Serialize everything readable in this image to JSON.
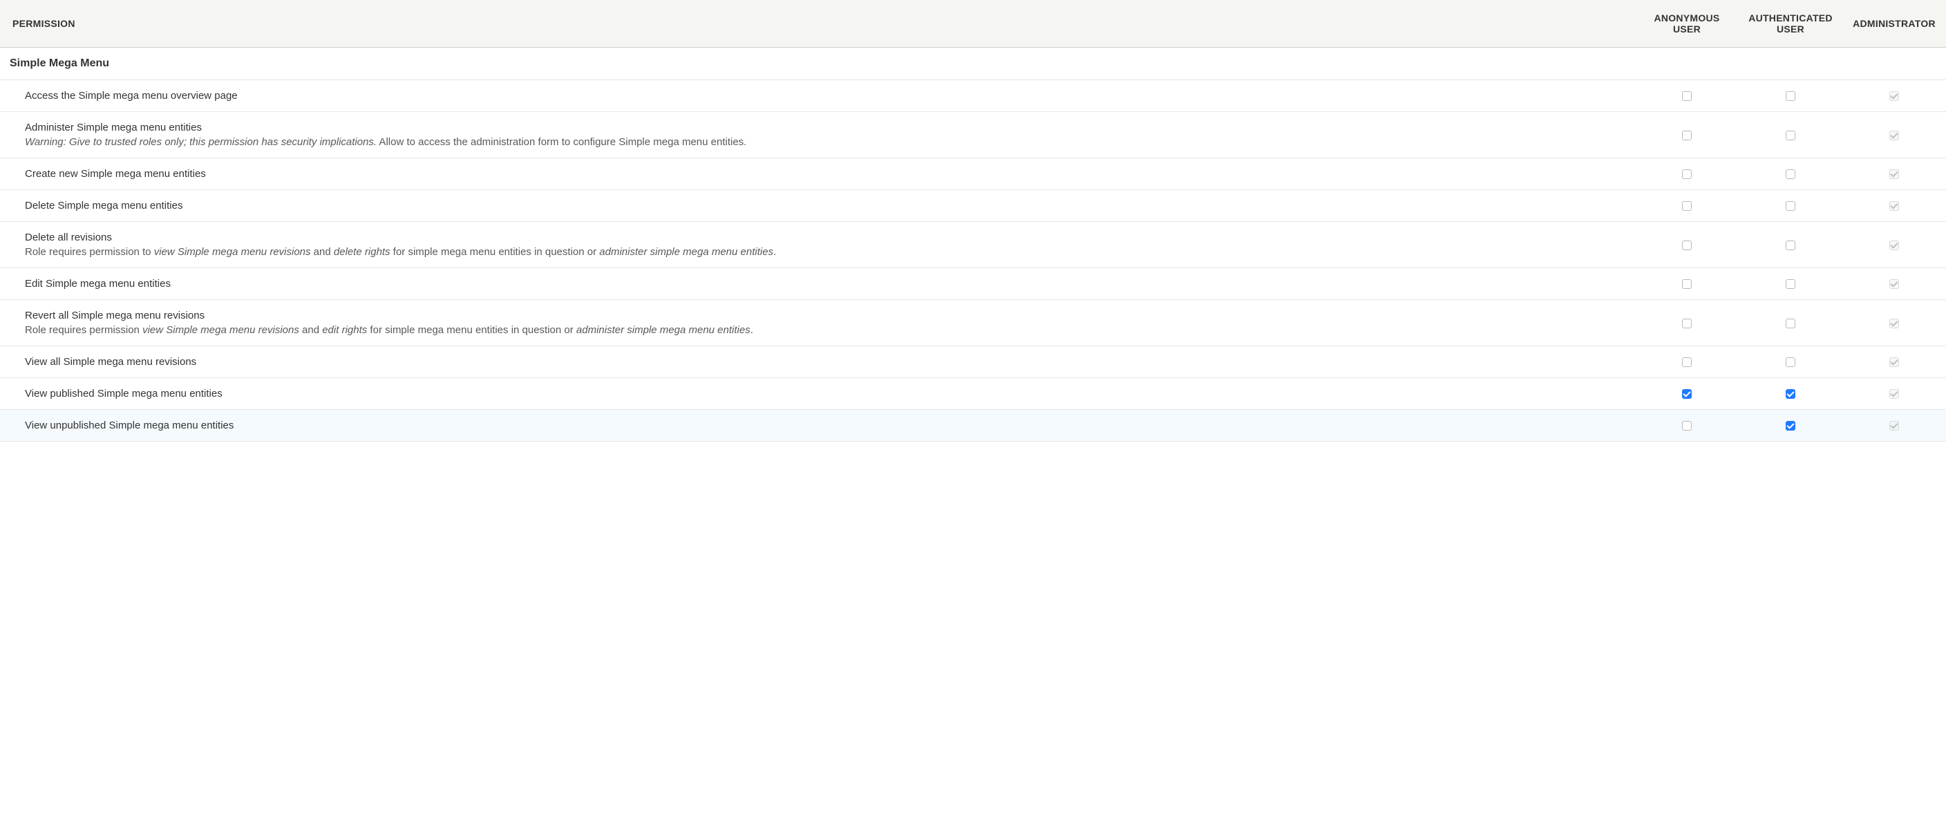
{
  "header": {
    "perm_col": "Permission",
    "roles": [
      "Anonymous user",
      "Authenticated user",
      "Administrator"
    ]
  },
  "module_label": "Simple Mega Menu",
  "permissions": [
    {
      "title": "Access the Simple mega menu overview page",
      "desc_parts": [],
      "cells": [
        {
          "checked": false,
          "disabled": false
        },
        {
          "checked": false,
          "disabled": false
        },
        {
          "checked": true,
          "disabled": true
        }
      ]
    },
    {
      "title": "Administer Simple mega menu entities",
      "desc_parts": [
        {
          "i": true,
          "t": "Warning: Give to trusted roles only; this permission has security implications."
        },
        {
          "i": false,
          "t": " Allow to access the administration form to configure Simple mega menu entities."
        }
      ],
      "cells": [
        {
          "checked": false,
          "disabled": false
        },
        {
          "checked": false,
          "disabled": false
        },
        {
          "checked": true,
          "disabled": true
        }
      ]
    },
    {
      "title": "Create new Simple mega menu entities",
      "desc_parts": [],
      "cells": [
        {
          "checked": false,
          "disabled": false
        },
        {
          "checked": false,
          "disabled": false
        },
        {
          "checked": true,
          "disabled": true
        }
      ]
    },
    {
      "title": "Delete Simple mega menu entities",
      "desc_parts": [],
      "cells": [
        {
          "checked": false,
          "disabled": false
        },
        {
          "checked": false,
          "disabled": false
        },
        {
          "checked": true,
          "disabled": true
        }
      ]
    },
    {
      "title": "Delete all revisions",
      "desc_parts": [
        {
          "i": false,
          "t": "Role requires permission to "
        },
        {
          "i": true,
          "t": "view Simple mega menu revisions"
        },
        {
          "i": false,
          "t": " and "
        },
        {
          "i": true,
          "t": "delete rights"
        },
        {
          "i": false,
          "t": " for simple mega menu entities in question or "
        },
        {
          "i": true,
          "t": "administer simple mega menu entities"
        },
        {
          "i": false,
          "t": "."
        }
      ],
      "cells": [
        {
          "checked": false,
          "disabled": false
        },
        {
          "checked": false,
          "disabled": false
        },
        {
          "checked": true,
          "disabled": true
        }
      ]
    },
    {
      "title": "Edit Simple mega menu entities",
      "desc_parts": [],
      "cells": [
        {
          "checked": false,
          "disabled": false
        },
        {
          "checked": false,
          "disabled": false
        },
        {
          "checked": true,
          "disabled": true
        }
      ]
    },
    {
      "title": "Revert all Simple mega menu revisions",
      "desc_parts": [
        {
          "i": false,
          "t": "Role requires permission "
        },
        {
          "i": true,
          "t": "view Simple mega menu revisions"
        },
        {
          "i": false,
          "t": " and "
        },
        {
          "i": true,
          "t": "edit rights"
        },
        {
          "i": false,
          "t": " for simple mega menu entities in question or "
        },
        {
          "i": true,
          "t": "administer simple mega menu entities"
        },
        {
          "i": false,
          "t": "."
        }
      ],
      "cells": [
        {
          "checked": false,
          "disabled": false
        },
        {
          "checked": false,
          "disabled": false
        },
        {
          "checked": true,
          "disabled": true
        }
      ]
    },
    {
      "title": "View all Simple mega menu revisions",
      "desc_parts": [],
      "cells": [
        {
          "checked": false,
          "disabled": false
        },
        {
          "checked": false,
          "disabled": false
        },
        {
          "checked": true,
          "disabled": true
        }
      ]
    },
    {
      "title": "View published Simple mega menu entities",
      "desc_parts": [],
      "cells": [
        {
          "checked": true,
          "disabled": false
        },
        {
          "checked": true,
          "disabled": false
        },
        {
          "checked": true,
          "disabled": true
        }
      ]
    },
    {
      "title": "View unpublished Simple mega menu entities",
      "desc_parts": [],
      "hovered": true,
      "cells": [
        {
          "checked": false,
          "disabled": false
        },
        {
          "checked": true,
          "disabled": false
        },
        {
          "checked": true,
          "disabled": true
        }
      ]
    }
  ]
}
